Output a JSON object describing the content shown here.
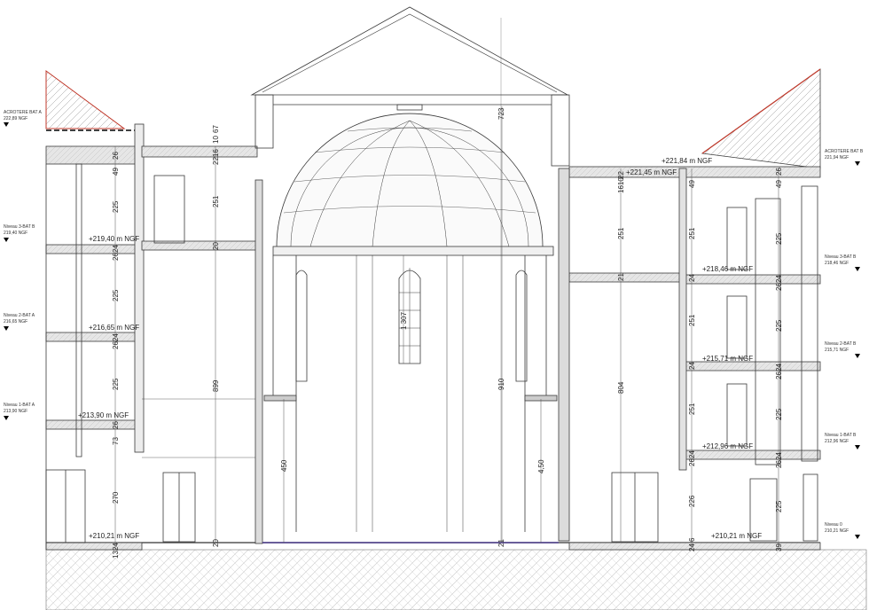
{
  "levels_left": [
    {
      "name": "ACROTERE BAT A",
      "value": "222,89 NGF"
    },
    {
      "name": "Niveau 3-BAT B",
      "value": "219,40 NGF"
    },
    {
      "name": "Niveau 2-BAT A",
      "value": "216,65 NGF"
    },
    {
      "name": "Niveau 1-BAT A",
      "value": "213,90 NGF"
    }
  ],
  "levels_right": [
    {
      "name": "ACROTERE BAT B",
      "value": "221,94 NGF"
    },
    {
      "name": "Niveau 3-BAT B",
      "value": "218,46 NGF"
    },
    {
      "name": "Niveau 2-BAT B",
      "value": "215,71 NGF"
    },
    {
      "name": "Niveau 1-BAT B",
      "value": "212,96 NGF"
    },
    {
      "name": "Niveau 0",
      "value": "210,21 NGF"
    }
  ],
  "ngf_marks": {
    "left_n3": "+219,40 m NGF",
    "left_n2": "+216,65 m NGF",
    "left_n1": "+213,90 m NGF",
    "left_n0": "+210,21 m NGF",
    "right_roof": "+221,84 m NGF",
    "right_top": "+221,45 m NGF",
    "right_n3": "+218,46 m NGF",
    "right_n2": "+215,71 m NGF",
    "right_n1": "+212,96 m NGF",
    "right_n0": "+210,21 m NGF"
  },
  "dims": {
    "l_26": "26",
    "l_49": "49",
    "l_225a": "225",
    "l_2624a": "2624",
    "l_225b": "225",
    "l_2624b": "2624",
    "l_225c": "225",
    "l_26c": "26",
    "l_73": "73",
    "l_270": "270",
    "l_1324": "1324",
    "c_2216": "2216",
    "c_10": "10",
    "c_67": "67",
    "c_251": "251",
    "c_20a": "20",
    "c_899": "899",
    "c_20b": "20",
    "c_450": "450",
    "c_723": "723",
    "c_1307": "1 307",
    "c_910": "910",
    "c_21": "21",
    "c_450b": "4,50",
    "c_804": "804",
    "r_22": "22",
    "r_1610": "1610",
    "r_251a": "251",
    "r_21": "21",
    "r_49": "49",
    "r_251b": "251",
    "r_24a": "24",
    "r_251c": "251",
    "r_24b": "24",
    "r_251d": "251",
    "r_2624a": "2624",
    "r_226": "226",
    "r_248": "24",
    "r_6": "6",
    "f_26": "26",
    "f_49": "49",
    "f_225a": "225",
    "f_2624a": "2624",
    "f_225b": "225",
    "f_2624b": "2624",
    "f_225c": "225",
    "f_2624c": "2624",
    "f_225d": "225",
    "f_39": "39"
  },
  "colors": {
    "line": "#3a3a3a",
    "roof": "#c0392b",
    "ground": "#f2f2f2"
  }
}
